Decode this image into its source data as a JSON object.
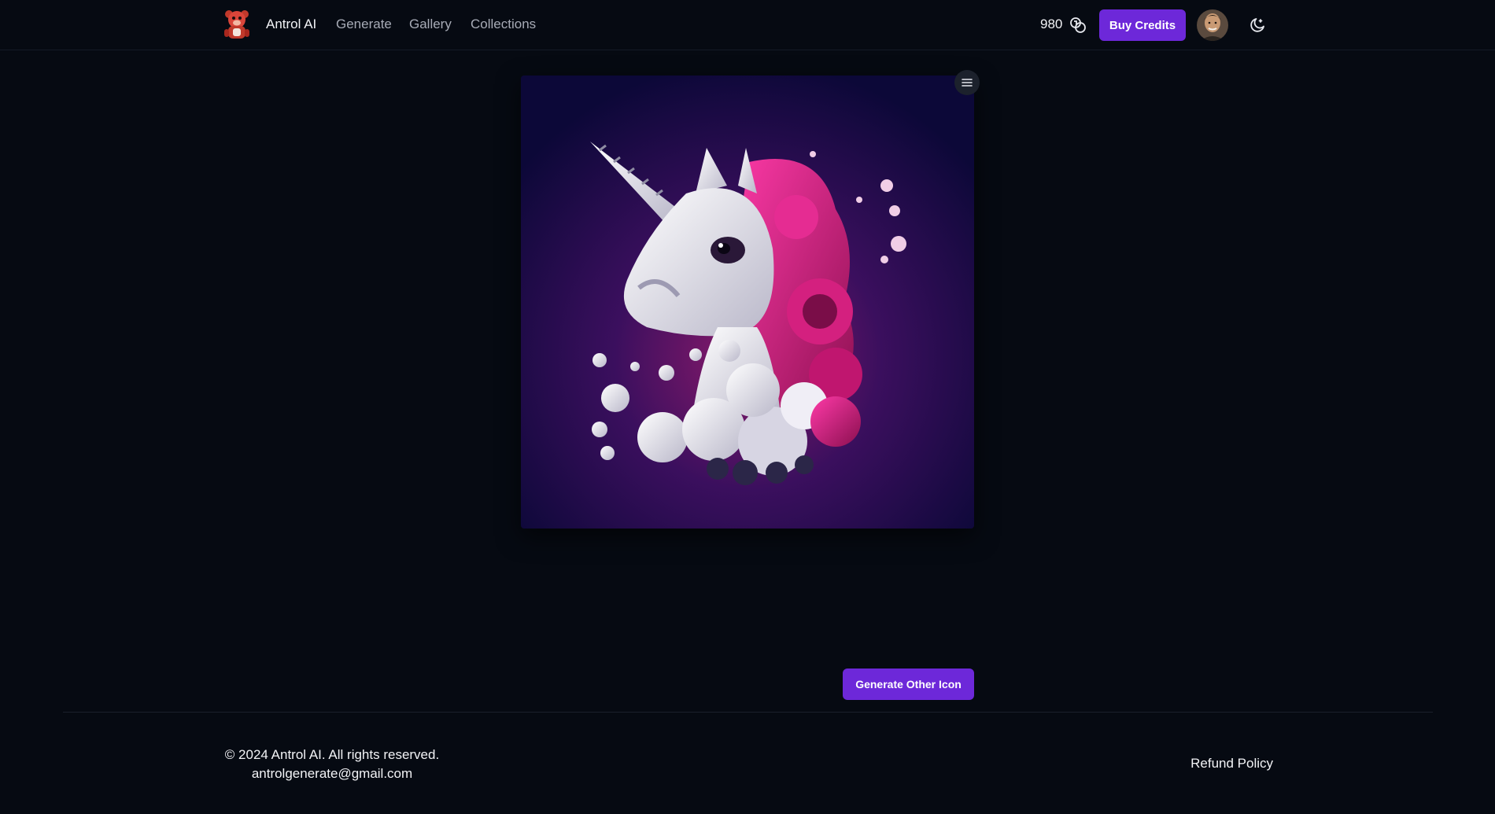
{
  "header": {
    "brand": "Antrol AI",
    "nav": [
      {
        "label": "Generate"
      },
      {
        "label": "Gallery"
      },
      {
        "label": "Collections"
      }
    ],
    "credits": "980",
    "buy_label": "Buy Credits",
    "icons": {
      "logo": "bear-logo-icon",
      "credits": "coins-icon",
      "theme": "moon-icon"
    }
  },
  "main": {
    "image_icon": "unicorn-artwork",
    "menu_icon": "hamburger-menu-icon",
    "generate_label": "Generate Other Icon"
  },
  "footer": {
    "copyright": "© 2024 Antrol AI. All rights reserved.",
    "email": "antrolgenerate@gmail.com",
    "refund": "Refund Policy"
  },
  "colors": {
    "background": "#060a12",
    "accent": "#6d28d9",
    "text": "#f2f3f6",
    "muted": "#a7abb6"
  }
}
